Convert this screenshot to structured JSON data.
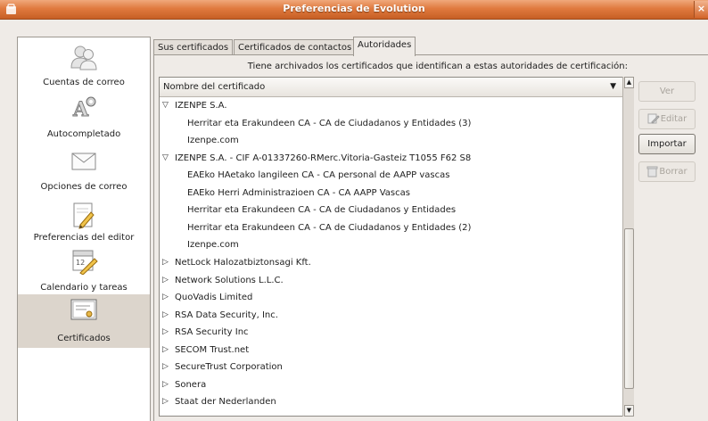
{
  "window": {
    "title": "Preferencias de Evolution",
    "close_glyph": "×",
    "icon": "window-menu-icon"
  },
  "categories": [
    {
      "label": "Cuentas de correo",
      "icon": "mail-accounts-icon"
    },
    {
      "label": "Autocompletado",
      "icon": "autocomplete-icon"
    },
    {
      "label": "Opciones de correo",
      "icon": "mail-options-icon"
    },
    {
      "label": "Preferencias del editor",
      "icon": "editor-preferences-icon"
    },
    {
      "label": "Calendario y tareas",
      "icon": "calendar-tasks-icon"
    },
    {
      "label": "Certificados",
      "icon": "certificates-icon",
      "selected": true
    }
  ],
  "tabs": [
    {
      "label": "Sus certificados"
    },
    {
      "label": "Certificados de contactos"
    },
    {
      "label": "Autoridades",
      "active": true
    }
  ],
  "description": "Tiene archivados los certificados que identifican a estas autoridades de certificación:",
  "tree": {
    "column_header": "Nombre del certificado",
    "sort_glyph": "▼",
    "rows": [
      {
        "text": "IZENPE S.A.",
        "level": 0,
        "expander": "▽"
      },
      {
        "text": "Herritar eta Erakundeen CA - CA de Ciudadanos y Entidades (3)",
        "level": 1
      },
      {
        "text": "Izenpe.com",
        "level": 1
      },
      {
        "text": "IZENPE S.A. - CIF A-01337260-RMerc.Vitoria-Gasteiz T1055 F62 S8",
        "level": 0,
        "expander": "▽"
      },
      {
        "text": "EAEko HAetako langileen CA - CA personal de AAPP vascas",
        "level": 1
      },
      {
        "text": "EAEko Herri Administrazioen CA - CA AAPP Vascas",
        "level": 1
      },
      {
        "text": "Herritar eta Erakundeen CA - CA de Ciudadanos y Entidades",
        "level": 1
      },
      {
        "text": "Herritar eta Erakundeen CA - CA de Ciudadanos y Entidades (2)",
        "level": 1
      },
      {
        "text": "Izenpe.com",
        "level": 1
      },
      {
        "text": "NetLock Halozatbiztonsagi Kft.",
        "level": 0,
        "expander": "▷"
      },
      {
        "text": "Network Solutions L.L.C.",
        "level": 0,
        "expander": "▷"
      },
      {
        "text": "QuoVadis Limited",
        "level": 0,
        "expander": "▷"
      },
      {
        "text": "RSA Data Security, Inc.",
        "level": 0,
        "expander": "▷"
      },
      {
        "text": "RSA Security Inc",
        "level": 0,
        "expander": "▷"
      },
      {
        "text": "SECOM Trust.net",
        "level": 0,
        "expander": "▷"
      },
      {
        "text": "SecureTrust Corporation",
        "level": 0,
        "expander": "▷"
      },
      {
        "text": "Sonera",
        "level": 0,
        "expander": "▷"
      },
      {
        "text": "Staat der Nederlanden",
        "level": 0,
        "expander": "▷"
      }
    ]
  },
  "scrollbar": {
    "up_glyph": "▲",
    "down_glyph": "▼"
  },
  "buttons": {
    "view": {
      "label": "Ver",
      "enabled": false
    },
    "edit": {
      "label": "Editar",
      "enabled": false,
      "icon": "edit-icon"
    },
    "import": {
      "label": "Importar",
      "enabled": true
    },
    "delete": {
      "label": "Borrar",
      "enabled": false,
      "icon": "trash-icon"
    }
  },
  "colors": {
    "titlebar": "#e07a3f",
    "selected_category": "#dcd5cc",
    "window_bg": "#efebe7"
  }
}
